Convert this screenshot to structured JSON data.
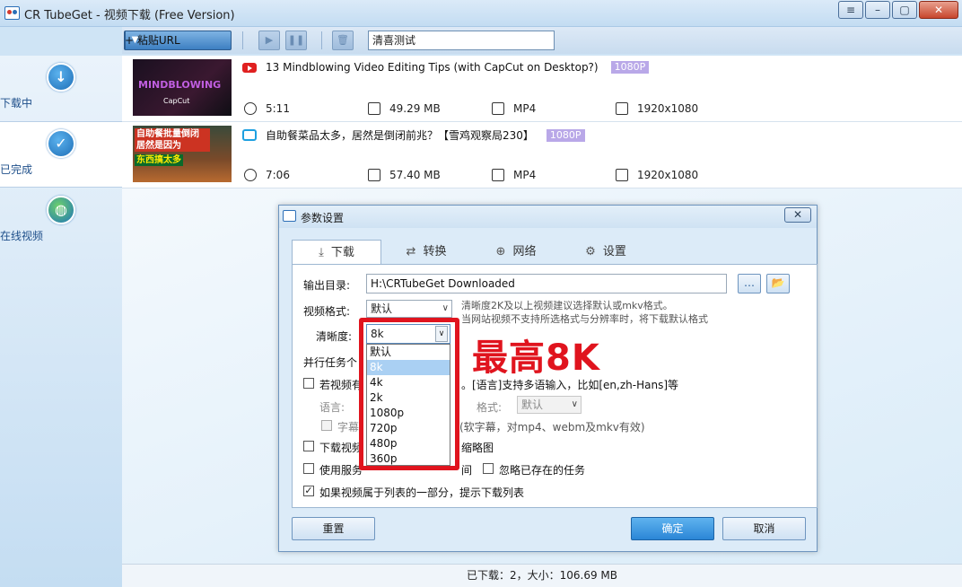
{
  "window": {
    "title": "CR TubeGet - 视频下载 (Free Version)",
    "controls": [
      "≡",
      "–",
      "▢",
      "✕"
    ]
  },
  "toolbar": {
    "paste_label": "+ 粘贴URL",
    "search_value": "清喜测试"
  },
  "sidebar": {
    "items": [
      {
        "label": "下载中",
        "icon": "download-icon"
      },
      {
        "label": "已完成",
        "icon": "check-icon"
      },
      {
        "label": "在线视频",
        "icon": "globe-icon"
      }
    ]
  },
  "videos": [
    {
      "title": "13 Mindblowing Video Editing Tips (with CapCut on Desktop?)",
      "badge": "1080P",
      "duration": "5:11",
      "size": "49.29 MB",
      "format": "MP4",
      "resolution": "1920x1080",
      "thumb_text": "MINDBLOWING",
      "thumb_sub": "CapCut",
      "source_icon": "youtube-icon"
    },
    {
      "title": "自助餐菜品太多，居然是倒闭前兆？【雪鸡观察局230】",
      "badge": "1080P",
      "duration": "7:06",
      "size": "57.40 MB",
      "format": "MP4",
      "resolution": "1920x1080",
      "thumb_text": "自助餐批量倒闭 居然是因为",
      "thumb_sub": "东西搞太多",
      "source_icon": "bilibili-icon"
    }
  ],
  "status": "已下载：2，大小：106.69 MB",
  "dialog": {
    "title": "参数设置",
    "tabs": [
      {
        "label": "下载",
        "icon": "download-icon"
      },
      {
        "label": "转换",
        "icon": "convert-icon"
      },
      {
        "label": "网络",
        "icon": "globe-icon"
      },
      {
        "label": "设置",
        "icon": "gear-icon"
      }
    ],
    "output_label": "输出目录:",
    "output_value": "H:\\CRTubeGet Downloaded",
    "format_label": "视频格式:",
    "format_value": "默认",
    "format_hint1": "清晰度2K及以上视频建议选择默认或mkv格式。",
    "format_hint2": "当网站视频不支持所选格式与分辨率时，将下载默认格式",
    "quality_label": "清晰度:",
    "quality_value": "8k",
    "quality_options": [
      "默认",
      "8k",
      "4k",
      "2k",
      "1080p",
      "720p",
      "480p",
      "360p"
    ],
    "parallel_label": "并行任务个",
    "subtitle_check": "若视频有",
    "subtitle_tail": "。[语言]支持多语输入，比如[en,zh-Hans]等",
    "lang_label": "语言:",
    "sub_format_label": "格式:",
    "sub_format_value": "默认",
    "sub_embed_label": "字幕",
    "sub_embed_tail": "(软字幕，对mp4、webm及mkv有效)",
    "thumb_check": "下载视频",
    "thumb_tail": "缩略图",
    "server_check": "使用服务",
    "server_tail": "间",
    "skip_label": "忽略已存在的任务",
    "playlist_label": "如果视频属于列表的一部分，提示下载列表",
    "reset_label": "重置",
    "ok_label": "确定",
    "cancel_label": "取消"
  },
  "annotation": "最高8K"
}
